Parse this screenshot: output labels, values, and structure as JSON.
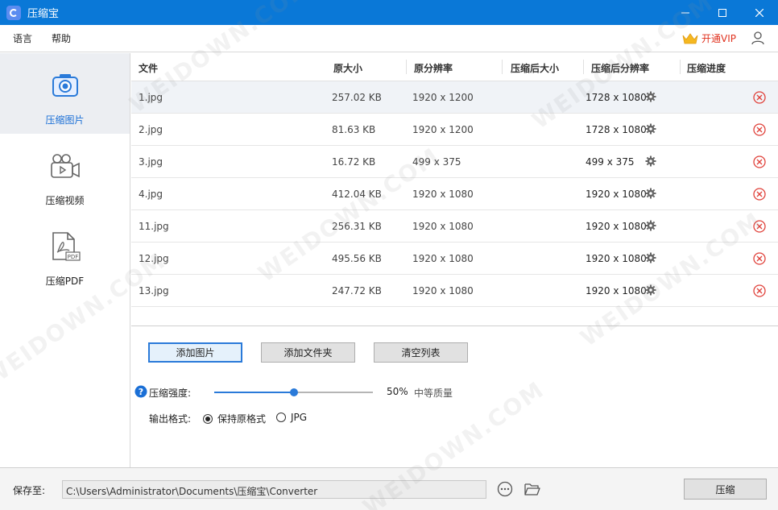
{
  "window": {
    "title": "压缩宝"
  },
  "menu": {
    "items": [
      "语言",
      "帮助"
    ],
    "vip_label": "开通VIP"
  },
  "sidebar": {
    "items": [
      {
        "label": "压缩图片",
        "icon": "camera-icon",
        "active": true
      },
      {
        "label": "压缩视频",
        "icon": "video-camera-icon",
        "active": false
      },
      {
        "label": "压缩PDF",
        "icon": "pdf-file-icon",
        "active": false
      }
    ]
  },
  "table": {
    "headers": [
      "文件",
      "原大小",
      "原分辨率",
      "压缩后大小",
      "压缩后分辨率",
      "压缩进度"
    ],
    "rows": [
      {
        "file": "1.jpg",
        "size": "257.02 KB",
        "res": "1920 x 1200",
        "out_size": "",
        "out_res": "1728 x 1080",
        "progress": ""
      },
      {
        "file": "2.jpg",
        "size": "81.63 KB",
        "res": "1920 x 1200",
        "out_size": "",
        "out_res": "1728 x 1080",
        "progress": ""
      },
      {
        "file": "3.jpg",
        "size": "16.72 KB",
        "res": "499 x 375",
        "out_size": "",
        "out_res": "499 x 375",
        "progress": ""
      },
      {
        "file": "4.jpg",
        "size": "412.04 KB",
        "res": "1920 x 1080",
        "out_size": "",
        "out_res": "1920 x 1080",
        "progress": ""
      },
      {
        "file": "11.jpg",
        "size": "256.31 KB",
        "res": "1920 x 1080",
        "out_size": "",
        "out_res": "1920 x 1080",
        "progress": ""
      },
      {
        "file": "12.jpg",
        "size": "495.56 KB",
        "res": "1920 x 1080",
        "out_size": "",
        "out_res": "1920 x 1080",
        "progress": ""
      },
      {
        "file": "13.jpg",
        "size": "247.72 KB",
        "res": "1920 x 1080",
        "out_size": "",
        "out_res": "1920 x 1080",
        "progress": ""
      }
    ]
  },
  "actions": {
    "add_image": "添加图片",
    "add_folder": "添加文件夹",
    "clear_list": "清空列表"
  },
  "compression": {
    "label": "压缩强度:",
    "percent_text": "50%",
    "value_fraction": 0.5,
    "quality_text": "中等质量"
  },
  "output_format": {
    "label": "输出格式:",
    "options": [
      "保持原格式",
      "JPG"
    ],
    "selected_index": 0
  },
  "footer": {
    "save_label": "保存至:",
    "path": "C:\\Users\\Administrator\\Documents\\压缩宝\\Converter",
    "compress_button": "压缩"
  },
  "watermark": "WEIDOWN.COM",
  "colors": {
    "titlebar": "#0a78d7",
    "accent": "#2a7ad9",
    "vip": "#e0321f",
    "delete": "#e0413a"
  }
}
